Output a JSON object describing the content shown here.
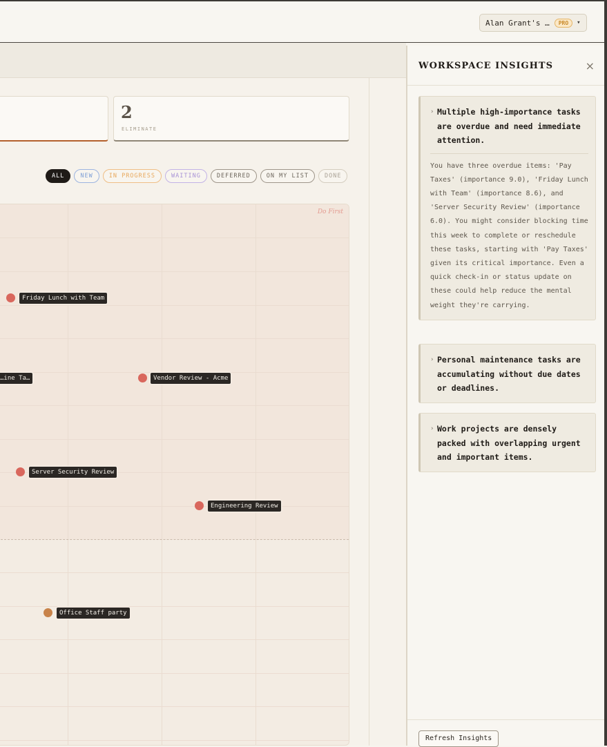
{
  "header": {
    "workspace_name": "Alan Grant's …",
    "workspace_badge": "PRO",
    "workspace_chevron": "chevron-down-icon"
  },
  "summary_cards": [
    {
      "label": "",
      "value": ""
    },
    {
      "label": "ELIMINATE",
      "value": "2"
    }
  ],
  "filters": [
    "ALL",
    "NEW",
    "IN PROGRESS",
    "WAITING",
    "DEFERRED",
    "ON MY LIST",
    "DONE"
  ],
  "matrix": {
    "quadrant_label": "Do First",
    "tasks": [
      {
        "label": "Friday Lunch with Team",
        "color": "#d9675d"
      },
      {
        "label": "…ine Ta…",
        "color": "#d9675d"
      },
      {
        "label": "Vendor Review - Acme",
        "color": "#d9675d"
      },
      {
        "label": "Server Security Review",
        "color": "#d9675d"
      },
      {
        "label": "Engineering Review",
        "color": "#d9675d"
      },
      {
        "label": "Office Staff party",
        "color": "#c8834a"
      }
    ]
  },
  "insights_panel": {
    "title": "WORKSPACE INSIGHTS",
    "close_icon": "close-icon",
    "insights": [
      {
        "headline": "Multiple high-importance tasks are overdue and need immediate attention.",
        "detail": "You have three overdue items: 'Pay Taxes' (importance 9.0), 'Friday Lunch with Team' (importance 8.6), and 'Server Security Review' (importance 6.0). You might consider blocking time this week to complete or reschedule these tasks, starting with 'Pay Taxes' given its critical importance. Even a quick check-in or status update on these could help reduce the mental weight they're carrying."
      },
      {
        "headline": "Personal maintenance tasks are accumulating without due dates or deadlines."
      },
      {
        "headline": "Work projects are densely packed with overlapping urgent and important items."
      }
    ],
    "refresh_label": "Refresh Insights"
  },
  "colors": {
    "accent": "#b4602c",
    "urgent_dot": "#d9675d",
    "later_dot": "#c8834a"
  }
}
